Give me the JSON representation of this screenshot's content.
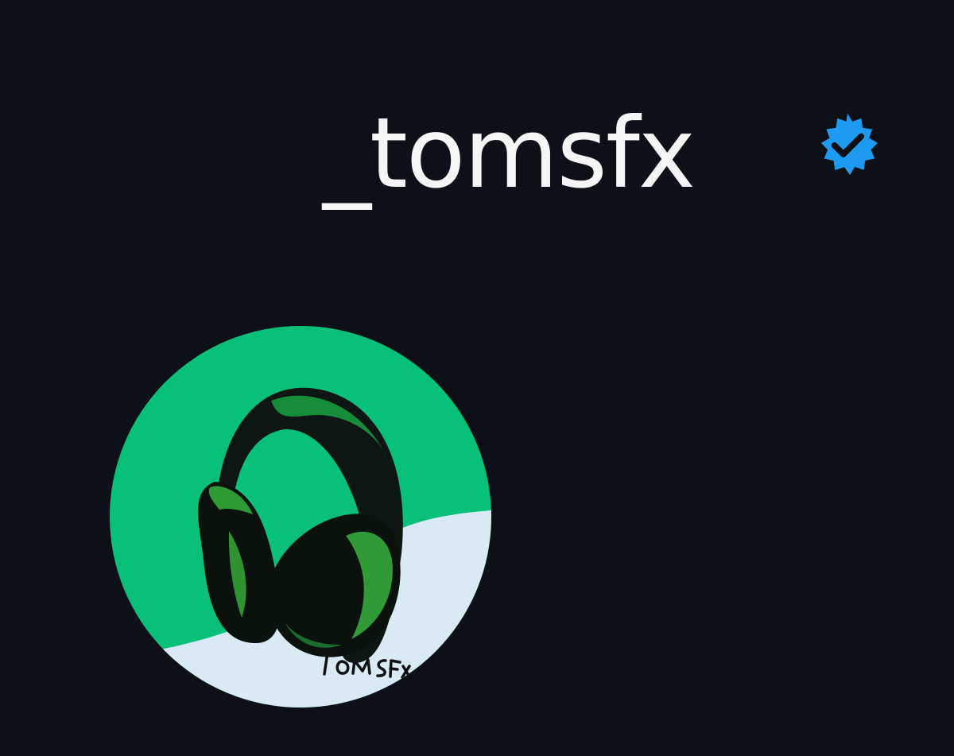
{
  "profile": {
    "username": "_tomsfx",
    "verified_icon": "verified-badge-icon",
    "avatar_icon": "headphones-avatar-icon",
    "avatar_signature": "TOMSFX"
  },
  "colors": {
    "background": "#0d1117",
    "username_text": "#f5f5f5",
    "verified_badge": "#1d9bf0",
    "avatar_green": "#08c07a",
    "avatar_light": "#d8ebf4"
  }
}
